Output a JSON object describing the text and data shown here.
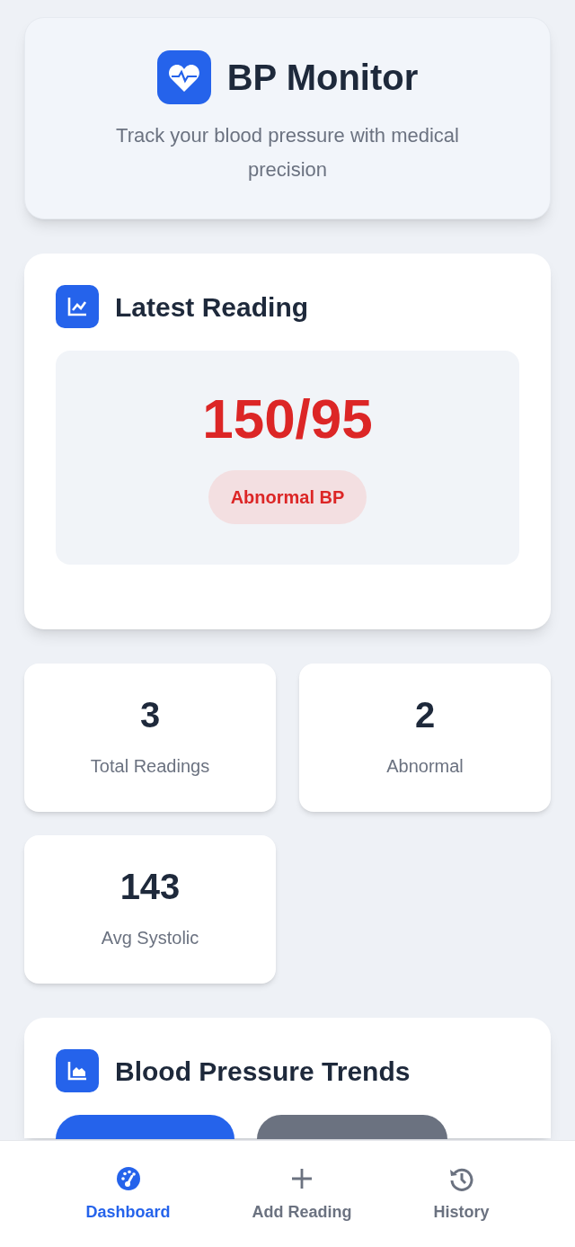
{
  "header": {
    "title": "BP Monitor",
    "subtitle": "Track your blood pressure with medical precision"
  },
  "latest_reading": {
    "title": "Latest Reading",
    "value": "150/95",
    "status": "Abnormal BP",
    "abnormal": true
  },
  "stats": [
    {
      "value": "3",
      "label": "Total Readings"
    },
    {
      "value": "2",
      "label": "Abnormal"
    },
    {
      "value": "143",
      "label": "Avg Systolic"
    }
  ],
  "trends": {
    "title": "Blood Pressure Trends",
    "tabs": [
      {
        "selected": true
      },
      {
        "selected": false
      }
    ]
  },
  "bottom_nav": [
    {
      "label": "Dashboard",
      "kind": "dashboard",
      "selected": true
    },
    {
      "label": "Add Reading",
      "kind": "add",
      "selected": false
    },
    {
      "label": "History",
      "kind": "history",
      "selected": false
    }
  ]
}
